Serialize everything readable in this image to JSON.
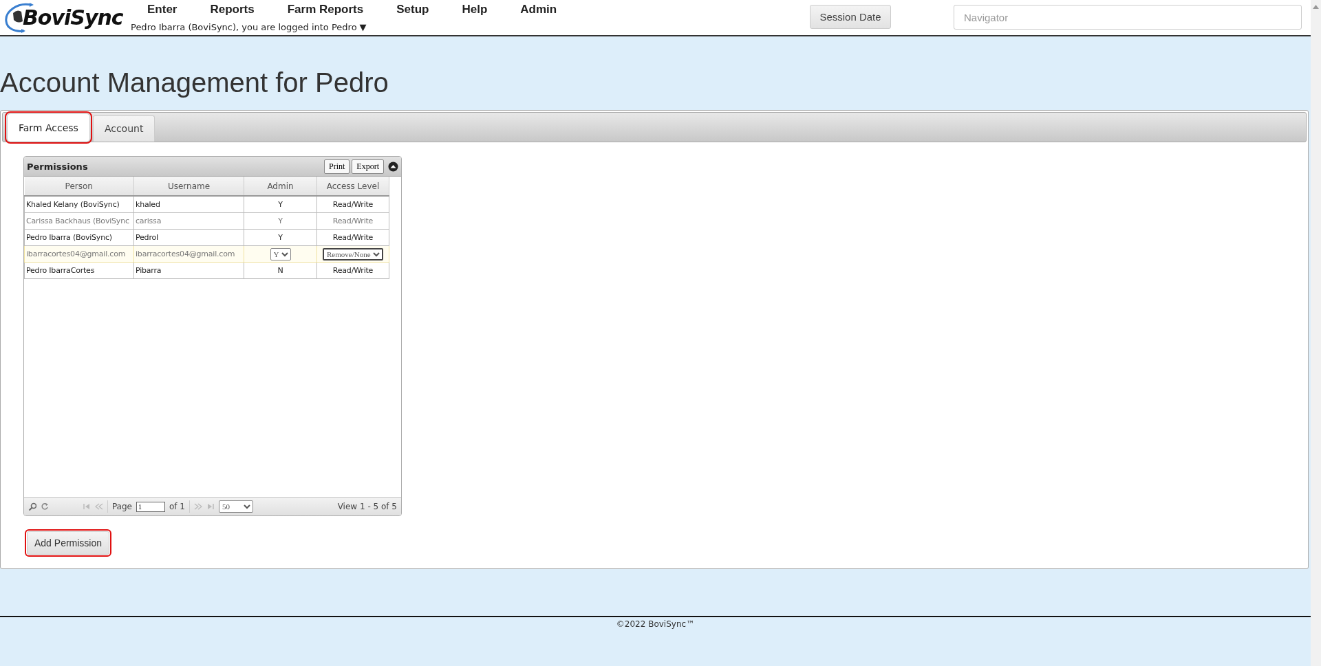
{
  "header": {
    "logo": "BoviSync",
    "menu": [
      "Enter",
      "Reports",
      "Farm Reports",
      "Setup",
      "Help",
      "Admin"
    ],
    "login_note": "Pedro Ibarra (BoviSync), you are logged into Pedro",
    "farm_caret": "▼",
    "session_button": "Session Date",
    "navigator": {
      "placeholder": "Navigator"
    }
  },
  "page_title": "Account Management for Pedro",
  "tabs": [
    {
      "label": "Farm Access",
      "selected": true,
      "highlighted": true
    },
    {
      "label": "Account",
      "selected": false,
      "highlighted": false
    }
  ],
  "grid": {
    "title": "Permissions",
    "buttons": [
      "Print",
      "Export"
    ],
    "columns": [
      "Person",
      "Username",
      "Admin",
      "Access Level"
    ],
    "rows": [
      {
        "kind": "view",
        "muted": false,
        "person": "Khaled Kelany (BoviSync)",
        "username": "khaled",
        "admin": "Y",
        "access_level": "Read/Write"
      },
      {
        "kind": "view",
        "muted": true,
        "person": "Carissa Backhaus (BoviSync",
        "username": "carissa",
        "admin": "Y",
        "access_level": "Read/Write"
      },
      {
        "kind": "view",
        "muted": false,
        "person": "Pedro Ibarra (BoviSync)",
        "username": "PedroI",
        "admin": "Y",
        "access_level": "Read/Write"
      },
      {
        "kind": "edit",
        "muted": true,
        "person": "ibarracortes04@gmail.com",
        "username": "ibarracortes04@gmail.com",
        "admin": "Y",
        "access_level": "Remove/None"
      },
      {
        "kind": "view",
        "muted": false,
        "person": "Pedro IbarraCortes",
        "username": "Pibarra",
        "admin": "N",
        "access_level": "Read/Write"
      }
    ],
    "pager": {
      "page_label": "Page",
      "page": "1",
      "of_label": "of 1",
      "page_size": "50",
      "view_text": "View 1 - 5 of 5"
    }
  },
  "add_button": {
    "label": "Add Permission",
    "highlighted": true
  },
  "footer": "©2022 BoviSync™"
}
